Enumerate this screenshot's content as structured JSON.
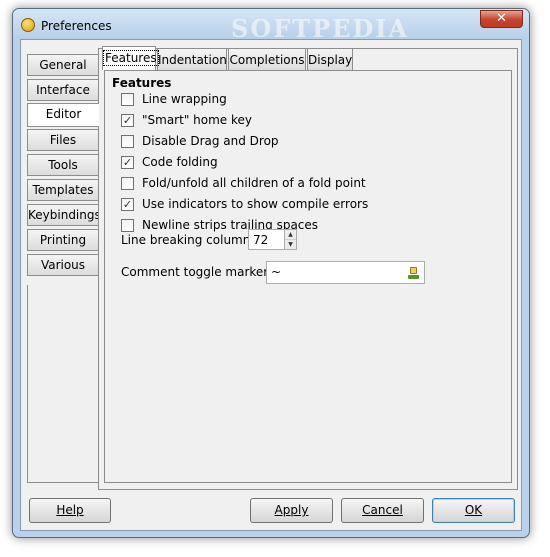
{
  "window": {
    "title": "Preferences",
    "watermark": "SOFTPEDIA",
    "close_glyph": "✕"
  },
  "side_tabs": [
    {
      "label": "General"
    },
    {
      "label": "Interface"
    },
    {
      "label": "Editor",
      "active": true
    },
    {
      "label": "Files"
    },
    {
      "label": "Tools"
    },
    {
      "label": "Templates"
    },
    {
      "label": "Keybindings"
    },
    {
      "label": "Printing"
    },
    {
      "label": "Various"
    }
  ],
  "top_tabs": [
    {
      "label": "Features",
      "active": true
    },
    {
      "label": "Indentation"
    },
    {
      "label": "Completions"
    },
    {
      "label": "Display"
    }
  ],
  "features": {
    "title": "Features",
    "options": [
      {
        "label": "Line wrapping",
        "checked": false
      },
      {
        "label": "\"Smart\" home key",
        "checked": true
      },
      {
        "label": "Disable Drag and Drop",
        "checked": false
      },
      {
        "label": "Code folding",
        "checked": true
      },
      {
        "label": "Fold/unfold all children of a fold point",
        "checked": false
      },
      {
        "label": "Use indicators to show compile errors",
        "checked": true
      },
      {
        "label": "Newline strips trailing spaces",
        "checked": false
      }
    ],
    "line_breaking": {
      "label": "Line breaking column:",
      "value": "72"
    },
    "comment_marker": {
      "label": "Comment toggle marker:",
      "value": "~"
    }
  },
  "buttons": {
    "help": "Help",
    "apply": "Apply",
    "cancel": "Cancel",
    "ok": "OK"
  },
  "colors": {
    "window_frame": "#b9d1ea",
    "close_button": "#c5432d",
    "default_button_border": "#3c7fb1"
  }
}
